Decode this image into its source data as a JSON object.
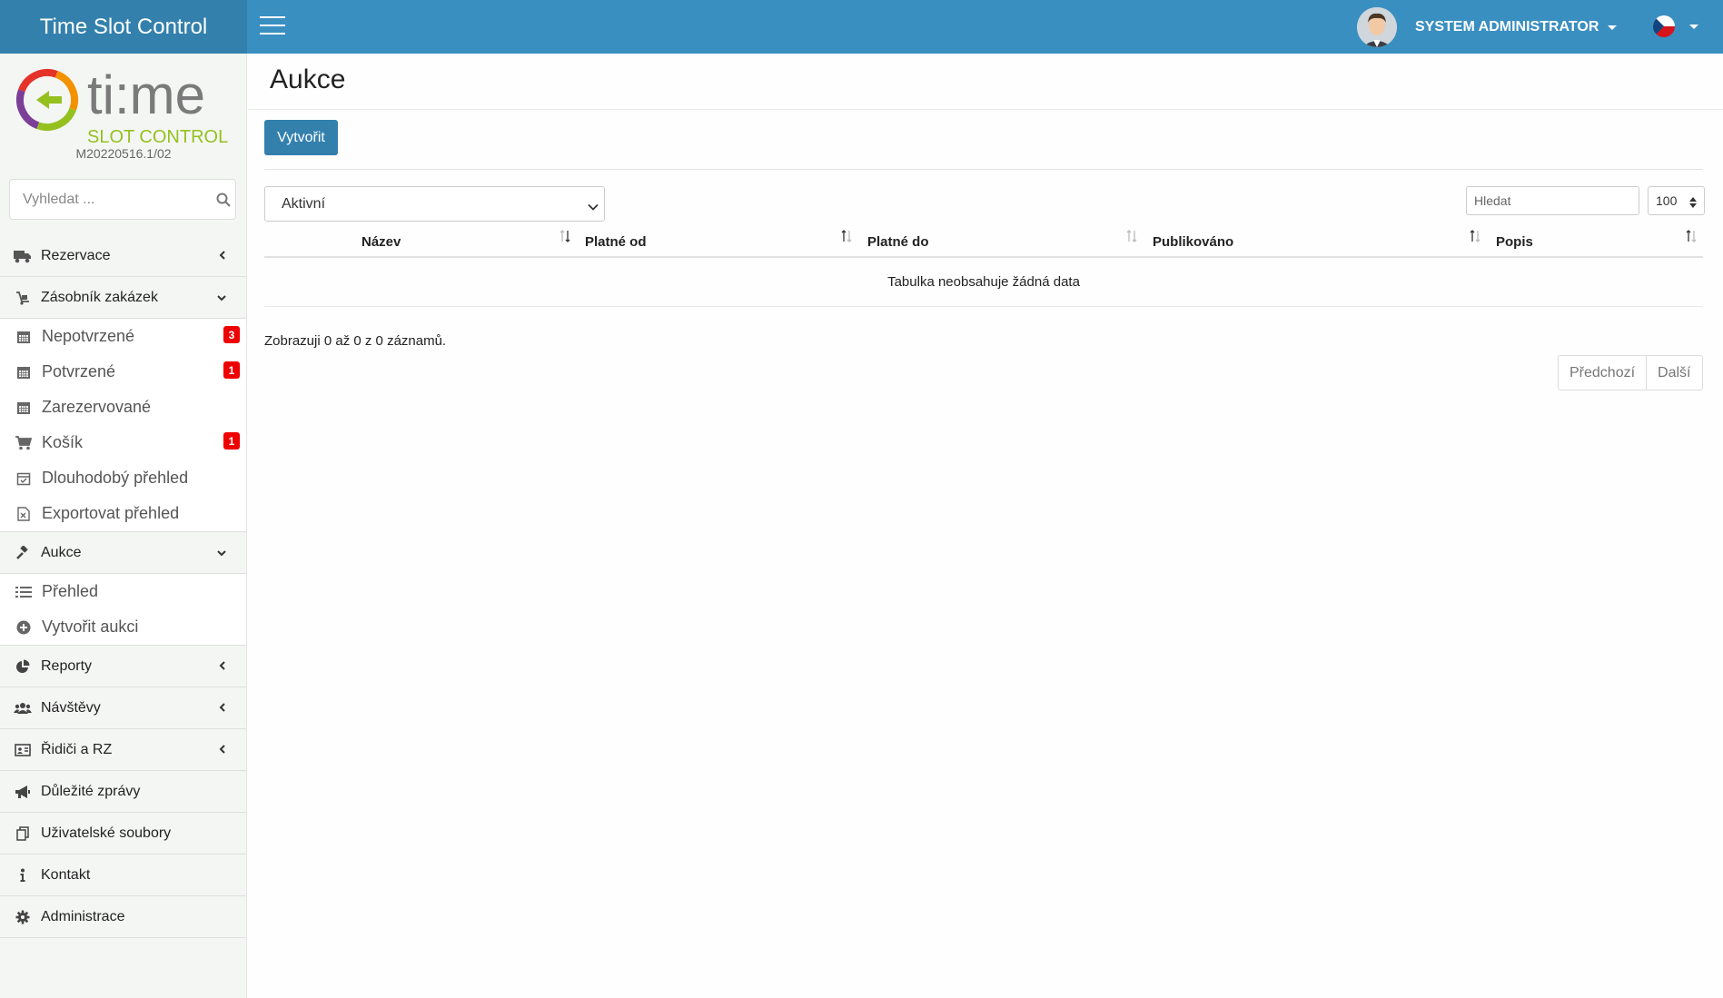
{
  "app": {
    "title": "Time Slot Control",
    "logo_text": "ti:me",
    "logo_subtext": "SLOT CONTROL",
    "version": "M20220516.1/02"
  },
  "header": {
    "user_name": "SYSTEM ADMINISTRATOR",
    "language": "cs"
  },
  "sidebar": {
    "search_placeholder": "Vyhledat ...",
    "items": [
      {
        "label": "Rezervace",
        "icon": "truck-icon"
      },
      {
        "label": "Zásobník zakázek",
        "icon": "dolly-icon",
        "children": [
          {
            "label": "Nepotvrzené",
            "icon": "calendar-icon",
            "badge": "3"
          },
          {
            "label": "Potvrzené",
            "icon": "calendar-icon",
            "badge": "1"
          },
          {
            "label": "Zarezervované",
            "icon": "calendar-icon",
            "badge": ""
          },
          {
            "label": "Košík",
            "icon": "cart-icon",
            "badge": "1"
          },
          {
            "label": "Dlouhodobý přehled",
            "icon": "calendar-check-icon",
            "badge": ""
          },
          {
            "label": "Exportovat přehled",
            "icon": "excel-file-icon",
            "badge": ""
          }
        ]
      },
      {
        "label": "Aukce",
        "icon": "gavel-icon",
        "children": [
          {
            "label": "Přehled",
            "icon": "list-icon"
          },
          {
            "label": "Vytvořit aukci",
            "icon": "plus-circle-icon"
          }
        ]
      },
      {
        "label": "Reporty",
        "icon": "pie-chart-icon"
      },
      {
        "label": "Návštěvy",
        "icon": "users-icon"
      },
      {
        "label": "Řidiči a RZ",
        "icon": "id-card-icon"
      },
      {
        "label": "Důležité zprávy",
        "icon": "megaphone-icon"
      },
      {
        "label": "Uživatelské soubory",
        "icon": "files-icon"
      },
      {
        "label": "Kontakt",
        "icon": "info-icon"
      },
      {
        "label": "Administrace",
        "icon": "gear-icon"
      }
    ]
  },
  "main": {
    "title": "Aukce",
    "create_label": "Vytvořit",
    "filter_value": "Aktivní",
    "search_placeholder": "Hledat",
    "page_size": "100",
    "columns": [
      "Název",
      "Platné od",
      "Platné do",
      "Publikováno",
      "Popis"
    ],
    "empty_text": "Tabulka neobsahuje žádná data",
    "info_text": "Zobrazuji 0 až 0 z 0 záznamů.",
    "prev_label": "Předchozí",
    "next_label": "Další"
  },
  "colors": {
    "topbar": "#3a8fc1",
    "brand": "#3380ad",
    "badge": "#e00000"
  }
}
